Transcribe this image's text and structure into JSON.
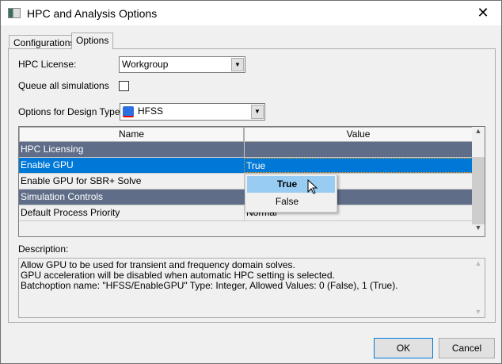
{
  "window": {
    "title": "HPC and Analysis Options",
    "close": "✕"
  },
  "tabs": [
    {
      "label": "Configurations",
      "active": false
    },
    {
      "label": "Options",
      "active": true
    }
  ],
  "form": {
    "hpc_license_label": "HPC License:",
    "hpc_license_value": "Workgroup",
    "queue_label": "Queue all simulations",
    "queue_checked": false,
    "design_type_label": "Options for Design Type:",
    "design_type_value": "HFSS"
  },
  "grid": {
    "headers": [
      "Name",
      "Value"
    ],
    "rows": [
      {
        "name": "HPC Licensing",
        "value": "",
        "type": "category"
      },
      {
        "name": "Enable GPU",
        "value": "True",
        "type": "selected"
      },
      {
        "name": "Enable GPU for SBR+ Solve",
        "value": "",
        "type": "normal"
      },
      {
        "name": "Simulation Controls",
        "value": "",
        "type": "category"
      },
      {
        "name": "Default Process Priority",
        "value": "Normal",
        "type": "normal"
      }
    ]
  },
  "dropdown": {
    "options": [
      "True",
      "False"
    ],
    "highlighted": "True"
  },
  "description": {
    "label": "Description:",
    "lines": [
      "Allow GPU to be used for transient and frequency domain solves.",
      "GPU acceleration will be disabled when automatic HPC setting is selected.",
      "Batchoption name: \"HFSS/EnableGPU\" Type: Integer, Allowed Values: 0 (False), 1 (True)."
    ]
  },
  "buttons": {
    "ok": "OK",
    "cancel": "Cancel"
  },
  "colors": {
    "category": "#5f6d88",
    "selection": "#0078d7",
    "dropdown_highlight": "#99ccf3"
  }
}
